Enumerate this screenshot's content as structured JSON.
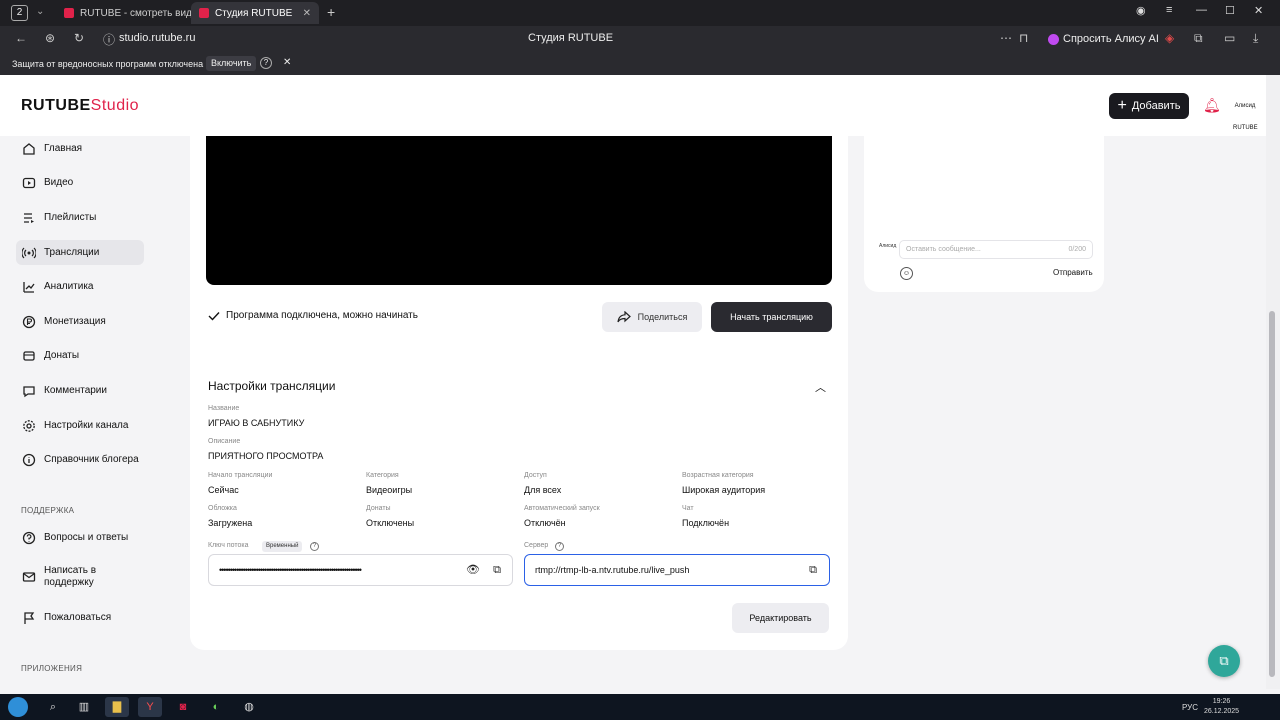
{
  "browser": {
    "tab_count": "2",
    "tabs": [
      {
        "label": "RUTUBE - смотреть виде"
      },
      {
        "label": "Студия RUTUBE"
      }
    ],
    "url": "studio.rutube.ru",
    "page_title": "Студия RUTUBE",
    "alice_label": "Спросить Алису AI",
    "infobar_text": "Защита от вредоносных программ отключена",
    "infobar_button": "Включить"
  },
  "header": {
    "logo_main": "RUTUBE",
    "logo_sub": "Studio",
    "add_label": "Добавить",
    "avatar_text": "Алисид RUTUBE"
  },
  "sidebar": {
    "items": [
      {
        "label": "Главная"
      },
      {
        "label": "Видео"
      },
      {
        "label": "Плейлисты"
      },
      {
        "label": "Трансляции"
      },
      {
        "label": "Аналитика"
      },
      {
        "label": "Монетизация"
      },
      {
        "label": "Донаты"
      },
      {
        "label": "Комментарии"
      },
      {
        "label": "Настройки канала"
      },
      {
        "label": "Справочник блогера"
      }
    ],
    "support_heading": "ПОДДЕРЖКА",
    "support_items": [
      {
        "label": "Вопросы и ответы"
      },
      {
        "label": "Написать в поддержку"
      },
      {
        "label": "Пожаловаться"
      }
    ],
    "apps_heading": "ПРИЛОЖЕНИЯ"
  },
  "player": {
    "status": "Программа подключена, можно начинать",
    "share_label": "Поделиться",
    "start_label": "Начать трансляцию"
  },
  "chat": {
    "placeholder": "Оставить сообщение...",
    "counter": "0/200",
    "send_label": "Отправить",
    "mini_label": "Алисид"
  },
  "settings": {
    "title": "Настройки трансляции",
    "name_label": "Название",
    "name_value": "ИГРАЮ В САБНУТИКУ",
    "desc_label": "Описание",
    "desc_value": "ПРИЯТНОГО ПРОСМОТРА",
    "fields": [
      {
        "label": "Начало трансляции",
        "value": "Сейчас"
      },
      {
        "label": "Категория",
        "value": "Видеоигры"
      },
      {
        "label": "Доступ",
        "value": "Для всех"
      },
      {
        "label": "Возрастная категория",
        "value": "Широкая аудитория"
      },
      {
        "label": "Обложка",
        "value": "Загружена"
      },
      {
        "label": "Донаты",
        "value": "Отключены"
      },
      {
        "label": "Автоматический запуск",
        "value": "Отключён"
      },
      {
        "label": "Чат",
        "value": "Подключён"
      }
    ],
    "key_label": "Ключ потока",
    "key_badge": "Временный",
    "key_value": "••••••••••••••••••••••••••••••••••••••••••••••••••••••••••••••••••",
    "server_label": "Сервер",
    "server_value": "rtmp://rtmp-lb-a.ntv.rutube.ru/live_push",
    "edit_label": "Редактировать"
  },
  "taskbar": {
    "lang": "РУС",
    "time": "19:26",
    "date": "26.12.2025"
  },
  "colors": {
    "accent": "#e0224a",
    "dark_button": "#2a2a30",
    "focus": "#2b61e6"
  }
}
